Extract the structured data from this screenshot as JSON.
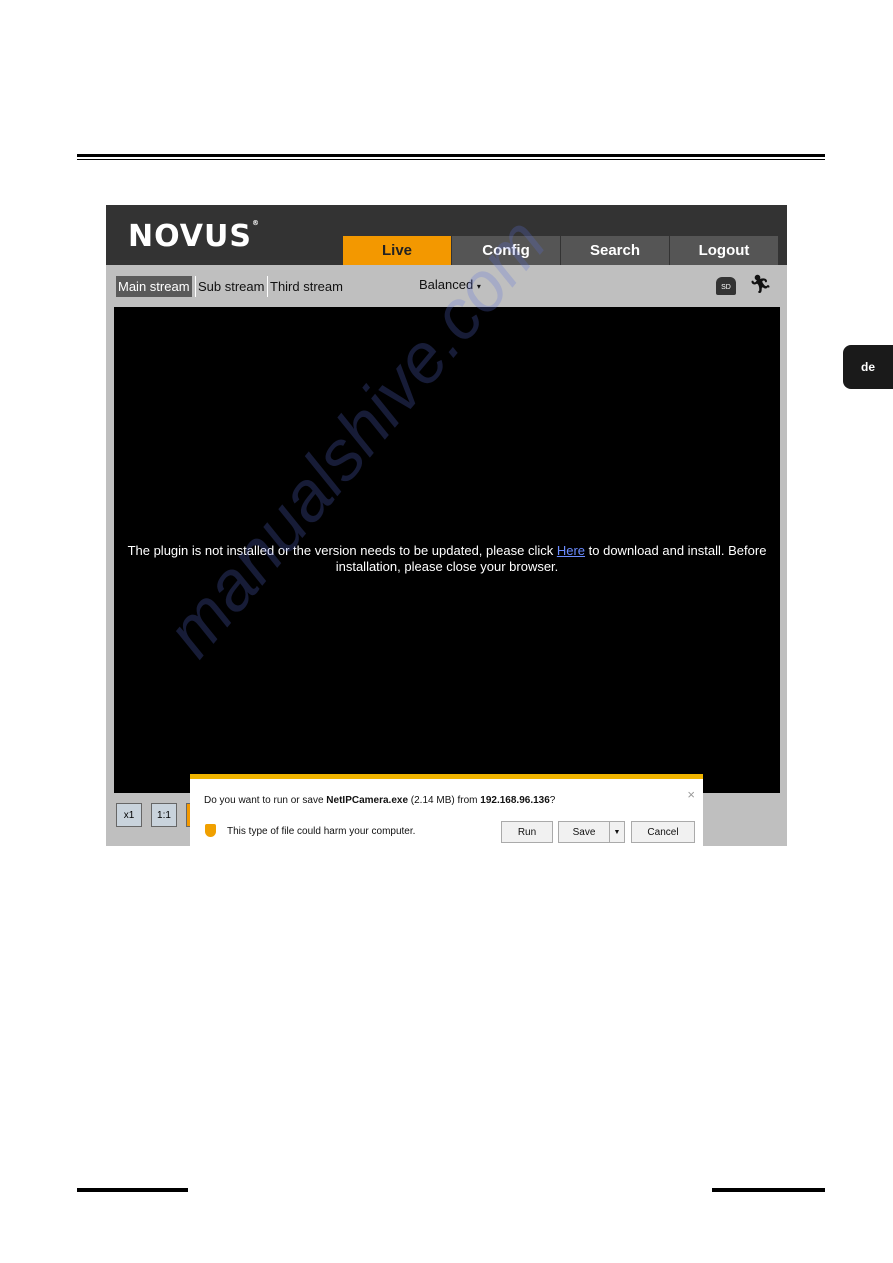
{
  "side_tab": "de",
  "app": {
    "logo": "NOVUS",
    "tabs": [
      {
        "label": "Live",
        "active": true
      },
      {
        "label": "Config"
      },
      {
        "label": "Search"
      },
      {
        "label": "Logout"
      }
    ],
    "streams": [
      "Main stream",
      "Sub stream",
      "Third stream"
    ],
    "selected_stream": "Main stream",
    "quality": "Balanced",
    "message_before": "The plugin is not installed or the version needs to be updated, please click ",
    "message_link": "Here",
    "message_after": " to download and install. Before installation, please close your browser.",
    "controls": [
      "x1",
      "1:1"
    ],
    "accent_color": "#f39800"
  },
  "dialog": {
    "q1": "Do you want to run or save ",
    "file": "NetIPCamera.exe",
    "size": " (2.14 MB) from ",
    "host": "192.168.96.136",
    "q2": "?",
    "warning": "This type of file could harm your computer.",
    "run": "Run",
    "save": "Save",
    "cancel": "Cancel",
    "close": "×"
  },
  "watermark": "manualshive.com"
}
